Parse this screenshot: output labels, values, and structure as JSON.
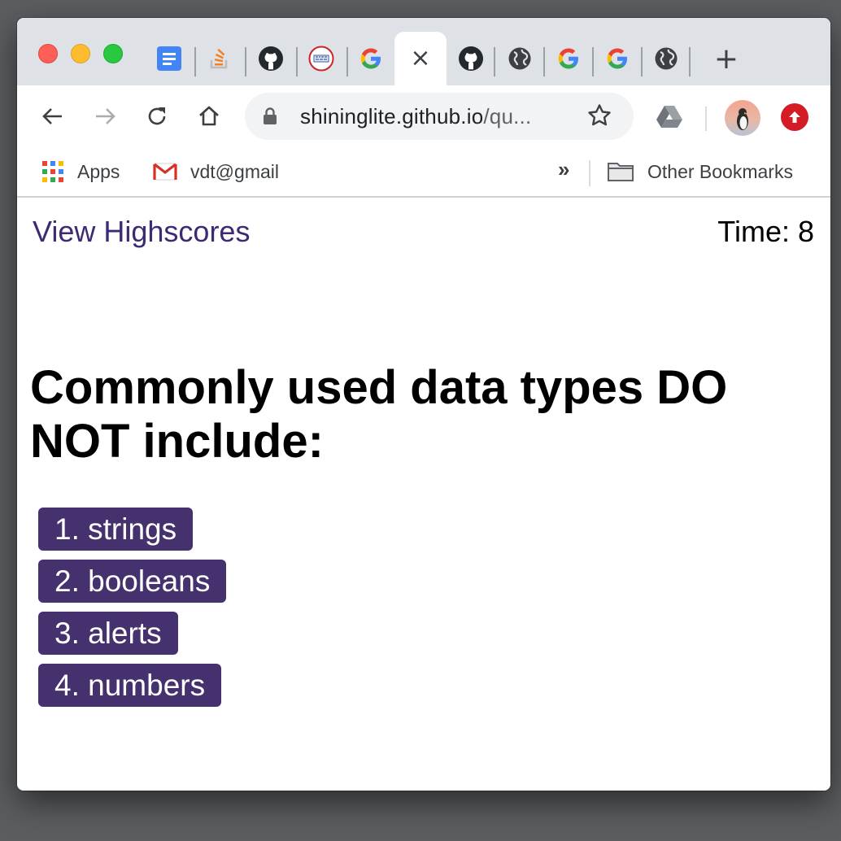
{
  "browser": {
    "tabs": [
      {
        "icon": "google-docs-icon"
      },
      {
        "icon": "stackoverflow-icon"
      },
      {
        "icon": "github-icon"
      },
      {
        "icon": "site-icon"
      },
      {
        "icon": "google-icon"
      },
      {
        "icon": "close-icon",
        "active": true
      },
      {
        "icon": "github-icon"
      },
      {
        "icon": "globe-icon"
      },
      {
        "icon": "google-icon"
      },
      {
        "icon": "google-icon"
      },
      {
        "icon": "globe-icon"
      }
    ],
    "new_tab_label": "+",
    "active_tab_close": "×",
    "address": {
      "host": "shininglite.github.io",
      "path": "/qu..."
    },
    "bookmarks": {
      "apps_label": "Apps",
      "gmail_label": "vdt@gmail",
      "overflow_label": "»",
      "other_label": "Other Bookmarks"
    },
    "colors": {
      "tabstrip": "#dee1e6",
      "update_badge": "#d31c26"
    }
  },
  "page": {
    "highscores_link": "View Highscores",
    "timer_label": "Time: ",
    "timer_value": "8",
    "question": "Commonly used data types DO NOT include:",
    "answers": [
      "1. strings",
      "2. booleans",
      "3. alerts",
      "4. numbers"
    ],
    "colors": {
      "accent": "#46316f",
      "link": "#3e2a72"
    }
  }
}
